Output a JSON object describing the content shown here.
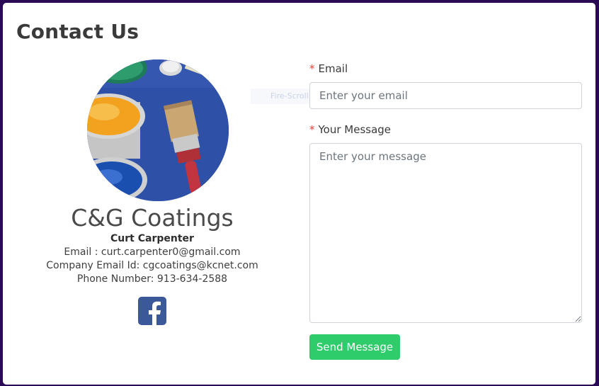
{
  "page": {
    "title": "Contact Us"
  },
  "profile": {
    "ghost_text": "Fire-Scroll",
    "company_name": "C&G Coatings",
    "contact_person": "Curt Carpenter",
    "email_line": "Email : curt.carpenter0@gmail.com",
    "company_email_line": "Company Email Id: cgcoatings@kcnet.com",
    "phone_line": "Phone Number: 913-634-2588"
  },
  "form": {
    "required_marker": "*",
    "email_label": "Email",
    "email_placeholder": "Enter your email",
    "email_value": "",
    "message_label": "Your Message",
    "message_placeholder": "Enter your message",
    "message_value": "",
    "send_label": "Send Message"
  },
  "social": {
    "facebook_icon": "facebook-icon"
  },
  "colors": {
    "background": "#2a0a55",
    "send_button": "#2ecc6a",
    "facebook": "#3b5998",
    "required": "#e0453a"
  }
}
